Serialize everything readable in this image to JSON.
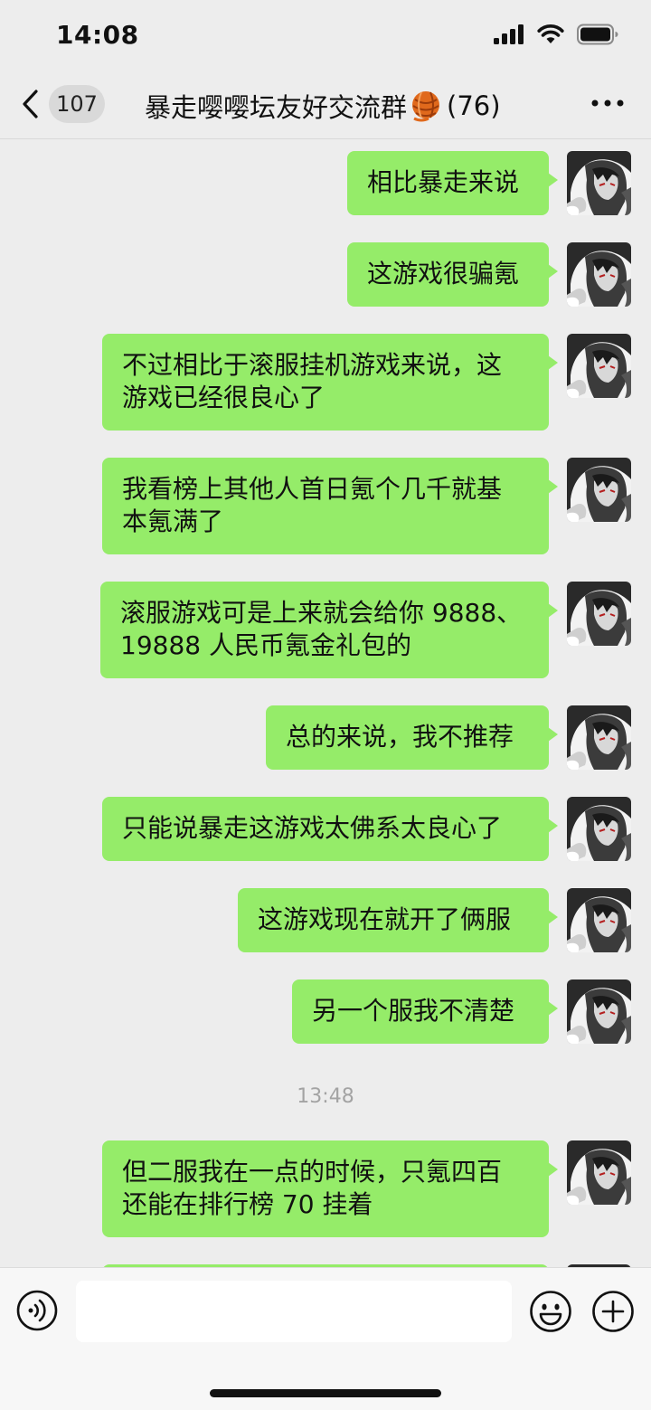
{
  "status_bar": {
    "time": "14:08"
  },
  "nav": {
    "unread_count": "107",
    "title": "暴走嘤嘤坛友好交流群",
    "member_count": "(76)"
  },
  "messages": [
    {
      "text": "相比暴走来说"
    },
    {
      "text": "这游戏很骗氪"
    },
    {
      "line1": "不过相比于滚服挂机游戏来说，这",
      "line2": "游戏已经很良心了"
    },
    {
      "line1": "我看榜上其他人首日氪个几千就基",
      "line2": "本氪满了"
    },
    {
      "line1": "滚服游戏可是上来就会给你 9888、",
      "line2": "19888 人民币氪金礼包的"
    },
    {
      "text": "总的来说，我不推荐"
    },
    {
      "text": "只能说暴走这游戏太佛系太良心了"
    },
    {
      "text": "这游戏现在就开了俩服"
    },
    {
      "text": "另一个服我不清楚"
    },
    {
      "line1": "但二服我在一点的时候，只氪四百",
      "line2": "还能在排行榜 70 挂着"
    }
  ],
  "timestamp": "13:48",
  "input": {
    "value": "",
    "placeholder": ""
  },
  "icons": {
    "back": "chevron-left-icon",
    "more": "more-dots-icon",
    "voice": "voice-icon",
    "emoji": "emoji-icon",
    "plus": "plus-icon",
    "title_emoji": "yarn-ball-icon"
  },
  "colors": {
    "bubble": "#95ec69",
    "background": "#ededed"
  }
}
